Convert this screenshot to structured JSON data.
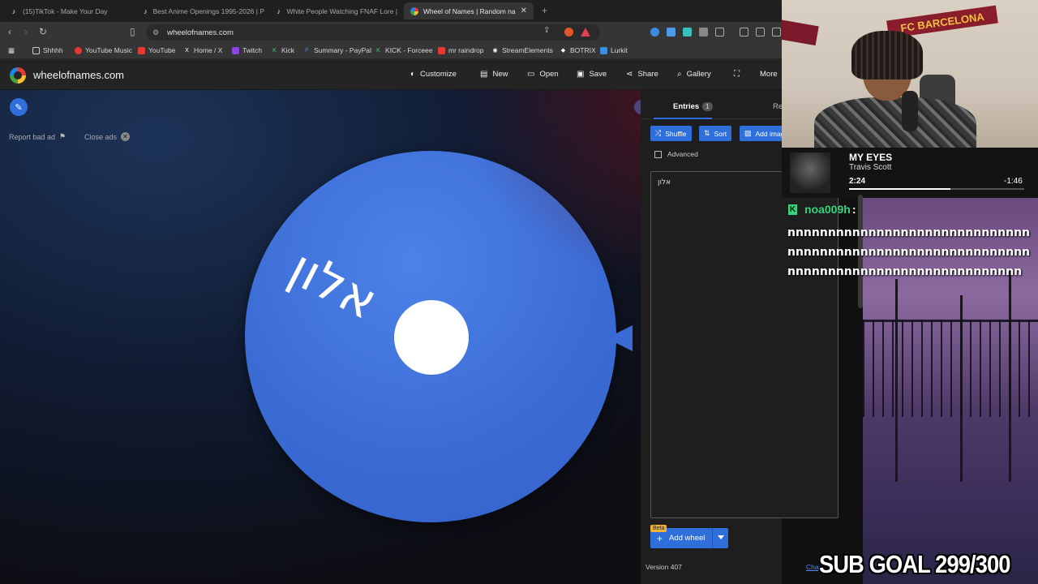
{
  "browser": {
    "tabs": [
      {
        "label": "(15)TikTok - Make Your Day",
        "icon": "tiktok-icon"
      },
      {
        "label": "Best Anime Openings 1995-2026 | P",
        "icon": "tiktok-icon"
      },
      {
        "label": "White People Watching FNAF Lore |",
        "icon": "tiktok-icon"
      },
      {
        "label": "Wheel of Names | Random name",
        "icon": "wheel-icon",
        "active": true
      }
    ],
    "url": "wheelofnames.com",
    "bookmarks": [
      "Shhhh",
      "YouTube Music",
      "YouTube",
      "Home / X",
      "Twitch",
      "Kick",
      "Summary - PayPal",
      "KICK - Forceee",
      "mr raindrop",
      "StreamElements",
      "BOTRIX",
      "Lurkit"
    ]
  },
  "site": {
    "name": "wheelofnames.com",
    "menu": [
      "Customize",
      "New",
      "Open",
      "Save",
      "Share",
      "Gallery",
      "More"
    ]
  },
  "stage": {
    "report_ad": "Report bad ad",
    "close_ads": "Close ads",
    "wheel_label": "אלון",
    "wheel_color": "#3a6bd4"
  },
  "panel": {
    "tab_entries": "Entries",
    "entries_count": "1",
    "tab_results": "Re",
    "btn_shuffle": "Shuffle",
    "btn_sort": "Sort",
    "btn_add_image": "Add imag",
    "advanced": "Advanced",
    "entry": "אלון",
    "beta": "Beta",
    "add_wheel": "Add wheel",
    "version": "Version 407",
    "changelog": "Cha"
  },
  "stream": {
    "now_playing": {
      "title": "MY EYES",
      "artist": "Travis Scott",
      "current": "2:24",
      "remaining": "-1:46",
      "progress": 0.58
    },
    "chat_user": "noa009h",
    "chat_message": "nnnnnnnnnnnnnnnnnnnnnnnnnnnnnnnnnnnnnnnnnnnnnnnnnnnnnnnnnnnnnnnnnnnnnnnnnnnnnnnnnnnnnnnnn",
    "flag_text": "FC BARCELONA",
    "sub_goal": "SUB GOAL 299/300"
  }
}
